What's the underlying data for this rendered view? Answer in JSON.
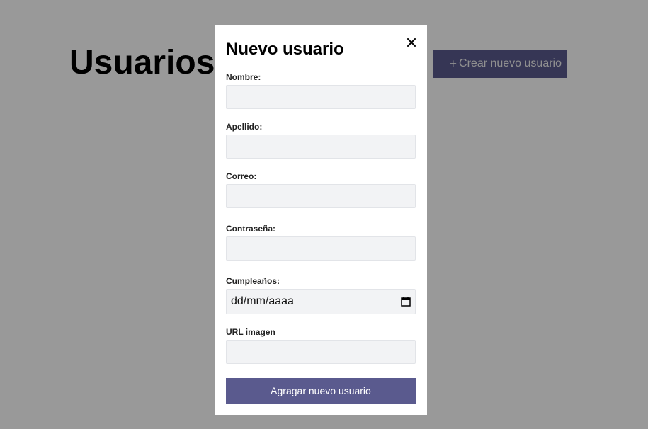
{
  "page": {
    "title": "Usuarios",
    "create_button_icon": "+",
    "create_button_label": "Crear nuevo usuario"
  },
  "modal": {
    "title": "Nuevo usuario",
    "close_icon": "close-icon",
    "fields": [
      {
        "label": "Nombre:",
        "value": "",
        "type": "text"
      },
      {
        "label": "Apellido:",
        "value": "",
        "type": "text"
      },
      {
        "label": "Correo:",
        "value": "",
        "type": "email"
      },
      {
        "label": "Contraseña:",
        "value": "",
        "type": "password"
      },
      {
        "label": "Cumpleaños:",
        "value": "dd/mm/aaaa",
        "type": "date"
      },
      {
        "label": "URL imagen",
        "value": "",
        "type": "url"
      }
    ],
    "submit_label": "Agragar nuevo usuario"
  },
  "colors": {
    "accent": "#5a5a8e",
    "overlay": "rgba(0,0,0,0.4)",
    "input_bg": "#f2f3f5"
  }
}
